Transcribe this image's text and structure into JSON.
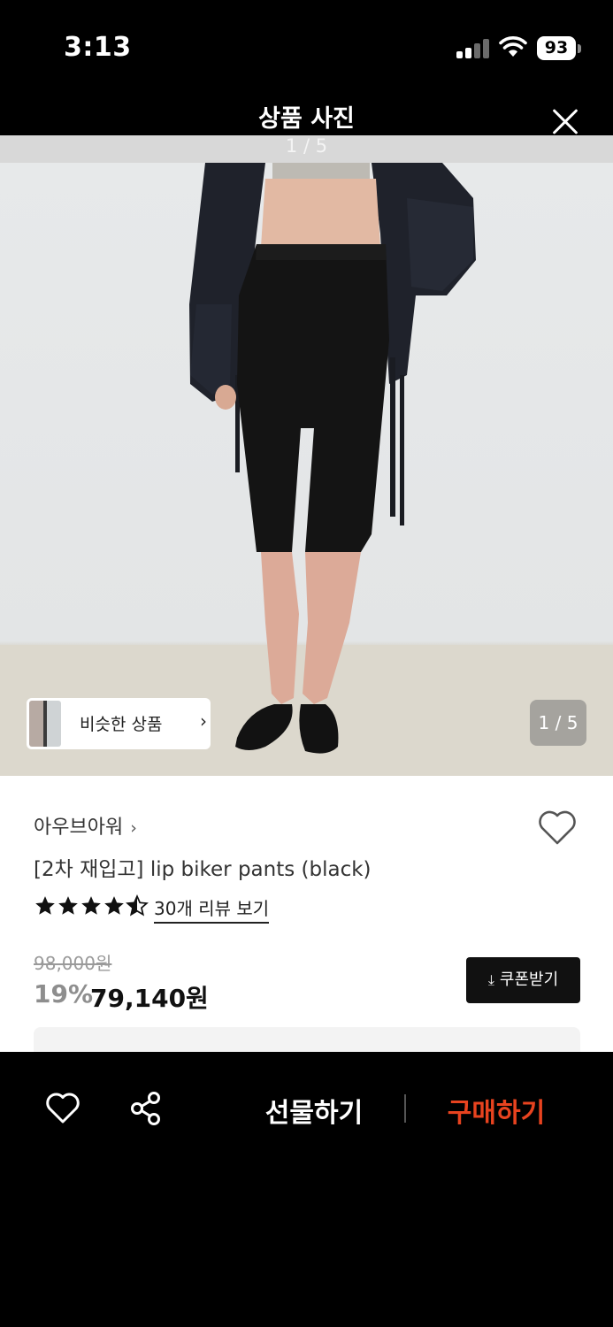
{
  "status_bar": {
    "time": "3:13",
    "battery": "93"
  },
  "modal": {
    "title": "상품 사진",
    "image_counter": "1 / 5"
  },
  "photo": {
    "alt": ""
  },
  "similar": {
    "label": "비슷한 상품",
    "chevron": "›"
  },
  "image_counter": "1 / 5",
  "product": {
    "brand": "아우브아워",
    "brand_chevron": "›",
    "name": "[2차 재입고] lip biker pants (black)",
    "rating": 4.5,
    "review_link": "30개 리뷰 보기",
    "original_price": "98,000원",
    "discount": "19%",
    "sale_price": "79,140원"
  },
  "coupon": {
    "icon": "download-icon",
    "label": "쿠폰받기",
    "glyph": "⤓"
  },
  "bottom_bar": {
    "gift_label": "선물하기",
    "buy_label": "구매하기",
    "buy_color": "#e8431f"
  }
}
